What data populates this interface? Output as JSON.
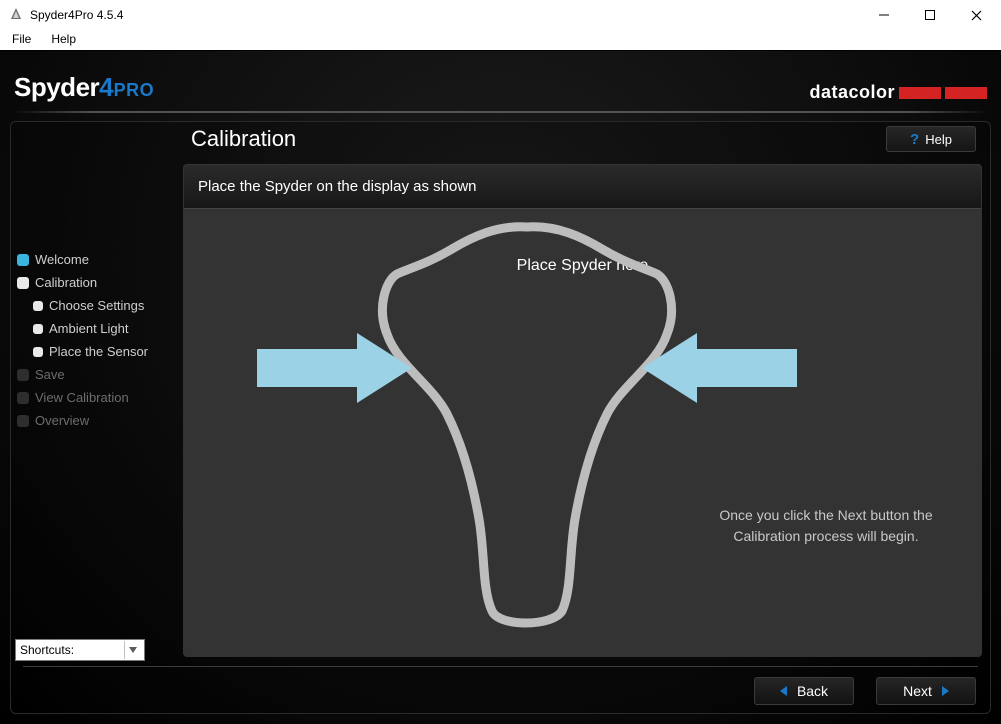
{
  "window": {
    "title": "Spyder4Pro 4.5.4",
    "menu": {
      "file": "File",
      "help": "Help"
    }
  },
  "branding": {
    "product_prefix": "Spyder",
    "product_num": "4",
    "product_suffix": "PRO",
    "company": "datacolor"
  },
  "page": {
    "title": "Calibration",
    "help_label": "Help",
    "instruction": "Place the Spyder on the display as shown",
    "placement_text": "Place Spyder here",
    "next_hint": "Once you click the Next button the Calibration process will begin."
  },
  "sidebar": {
    "items": [
      {
        "label": "Welcome",
        "kind": "top",
        "state": "done",
        "bullet": "blue"
      },
      {
        "label": "Calibration",
        "kind": "top",
        "state": "current",
        "bullet": "white"
      },
      {
        "label": "Choose Settings",
        "kind": "sub",
        "state": "available",
        "bullet": "whitesub"
      },
      {
        "label": "Ambient Light",
        "kind": "sub",
        "state": "available",
        "bullet": "whitesub"
      },
      {
        "label": "Place the Sensor",
        "kind": "sub",
        "state": "available",
        "bullet": "whitesub"
      },
      {
        "label": "Save",
        "kind": "top",
        "state": "disabled",
        "bullet": "dim"
      },
      {
        "label": "View Calibration",
        "kind": "top",
        "state": "disabled",
        "bullet": "dim"
      },
      {
        "label": "Overview",
        "kind": "top",
        "state": "disabled",
        "bullet": "dim"
      }
    ]
  },
  "shortcuts": {
    "label": "Shortcuts:"
  },
  "footer": {
    "back": "Back",
    "next": "Next"
  },
  "colors": {
    "accent_blue": "#1a79c8",
    "arrow_blue": "#9cd2e6",
    "outline_gray": "#bdbdbd",
    "brand_red": "#d32323"
  }
}
